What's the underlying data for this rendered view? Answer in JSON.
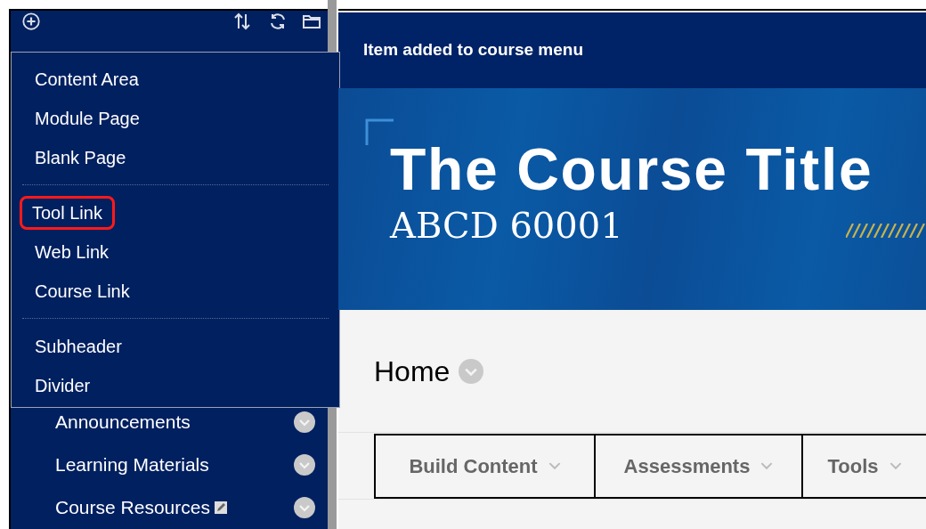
{
  "sidebar": {
    "items": [
      {
        "label": "Announcements",
        "editable": false
      },
      {
        "label": "Learning Materials",
        "editable": false
      },
      {
        "label": "Course Resources",
        "editable": true
      }
    ]
  },
  "add_menu": {
    "groups": [
      {
        "items": [
          {
            "label": "Content Area",
            "highlighted": false
          },
          {
            "label": "Module Page",
            "highlighted": false
          },
          {
            "label": "Blank Page",
            "highlighted": false
          }
        ]
      },
      {
        "items": [
          {
            "label": "Tool Link",
            "highlighted": true
          },
          {
            "label": "Web Link",
            "highlighted": false
          },
          {
            "label": "Course Link",
            "highlighted": false
          }
        ]
      },
      {
        "items": [
          {
            "label": "Subheader",
            "highlighted": false
          },
          {
            "label": "Divider",
            "highlighted": false
          }
        ]
      }
    ]
  },
  "notice": "Item added to course menu",
  "banner": {
    "title": "The Course Title",
    "code": "ABCD 60001"
  },
  "page_title": "Home",
  "action_bar": [
    "Build Content",
    "Assessments",
    "Tools"
  ]
}
